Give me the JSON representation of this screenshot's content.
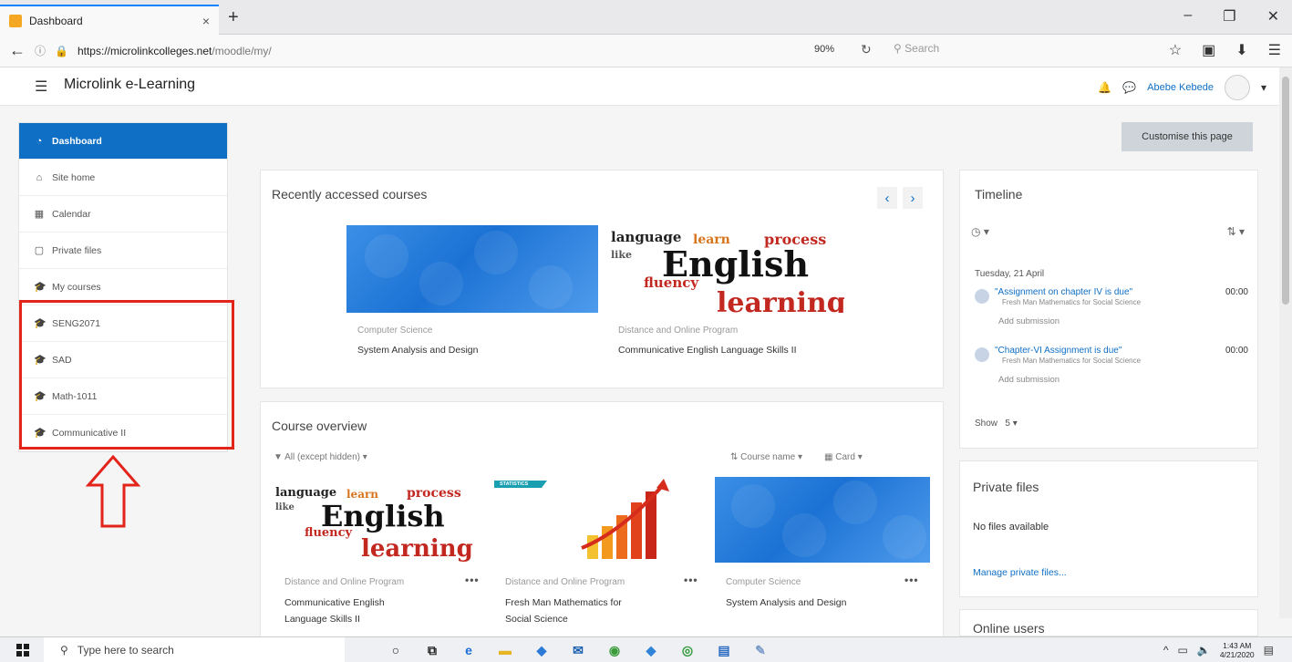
{
  "browser": {
    "tab_title": "Dashboard",
    "tab_close": "×",
    "new_tab": "+",
    "url_domain": "https://microlinkcolleges.net",
    "url_path": "/moodle/my/",
    "zoom": "90%",
    "search_placeholder": "Search"
  },
  "header": {
    "site_name": "Microlink e-Learning",
    "user_name": "Abebe Kebede"
  },
  "nav": {
    "items": [
      {
        "label": "Dashboard"
      },
      {
        "label": "Site home"
      },
      {
        "label": "Calendar"
      },
      {
        "label": "Private files"
      },
      {
        "label": "My courses"
      },
      {
        "label": "SENG2071"
      },
      {
        "label": "SAD"
      },
      {
        "label": "Math-1011"
      },
      {
        "label": "Communicative II"
      }
    ]
  },
  "customise_label": "Customise this page",
  "recent": {
    "title": "Recently accessed courses",
    "courses": [
      {
        "category": "Computer Science",
        "name": "System Analysis and Design"
      },
      {
        "category": "Distance and Online Program",
        "name": "Communicative English Language Skills II"
      }
    ]
  },
  "overview": {
    "title": "Course overview",
    "filter": "All (except hidden)",
    "sort": "Course name",
    "view": "Card",
    "courses": [
      {
        "category": "Distance and Online Program",
        "name_line1": "Communicative English",
        "name_line2": "Language Skills II"
      },
      {
        "category": "Distance and Online Program",
        "name_line1": "Fresh Man Mathematics for",
        "name_line2": "Social Science",
        "badge": "STATISTICS"
      },
      {
        "category": "Computer Science",
        "name_line1": "System Analysis and Design",
        "name_line2": ""
      }
    ]
  },
  "wordcloud": {
    "language": "language",
    "learn": "learn",
    "process": "process",
    "like": "like",
    "english": "English",
    "fluency": "fluency",
    "learning": "learning"
  },
  "timeline": {
    "title": "Timeline",
    "date": "Tuesday, 21 April",
    "events": [
      {
        "title": "\"Assignment on chapter IV is due\"",
        "course": "Fresh Man Mathematics for Social Science",
        "time": "00:00",
        "action": "Add submission"
      },
      {
        "title": "\"Chapter-VI Assignment is due\"",
        "course": "Fresh Man Mathematics for Social Science",
        "time": "00:00",
        "action": "Add submission"
      }
    ],
    "show_label": "Show",
    "show_value": "5"
  },
  "private_files": {
    "title": "Private files",
    "empty": "No files available",
    "manage": "Manage private files..."
  },
  "online_users": {
    "title": "Online users"
  },
  "taskbar": {
    "search": "Type here to search",
    "time": "1:43 AM",
    "date": "4/21/2020"
  },
  "colors": {
    "accent": "#0f6fc5",
    "highlight": "#e3241b"
  }
}
